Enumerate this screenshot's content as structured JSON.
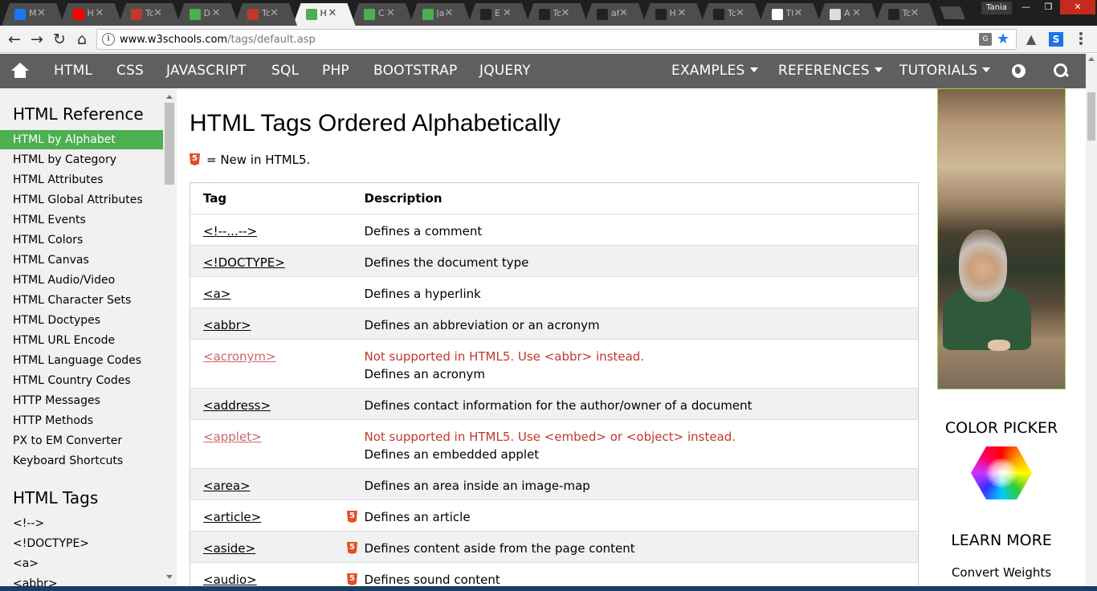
{
  "browser": {
    "tabs": [
      {
        "title": "M",
        "icon": "messenger-icon",
        "color": "#1877f2"
      },
      {
        "title": "H",
        "icon": "youtube-icon",
        "color": "#ff0000"
      },
      {
        "title": "Tc",
        "icon": "robot-icon",
        "color": "#c0392b"
      },
      {
        "title": "D",
        "icon": "leaf-icon",
        "color": "#4caf50"
      },
      {
        "title": "Tc",
        "icon": "robot-icon",
        "color": "#c0392b"
      },
      {
        "title": "H",
        "icon": "w3schools-icon",
        "color": "#4caf50",
        "active": true
      },
      {
        "title": "C",
        "icon": "w3schools-icon",
        "color": "#4caf50"
      },
      {
        "title": "Ja",
        "icon": "w3schools-icon",
        "color": "#4caf50"
      },
      {
        "title": "E",
        "icon": "github-icon",
        "color": "#222222"
      },
      {
        "title": "Tc",
        "icon": "github-icon",
        "color": "#222222"
      },
      {
        "title": "af",
        "icon": "github-icon",
        "color": "#222222"
      },
      {
        "title": "H",
        "icon": "github-icon",
        "color": "#222222"
      },
      {
        "title": "Tc",
        "icon": "github-icon",
        "color": "#222222"
      },
      {
        "title": "Tl",
        "icon": "wikipedia-icon",
        "color": "#ffffff"
      },
      {
        "title": "A",
        "icon": "document-icon",
        "color": "#dddddd"
      },
      {
        "title": "Tc",
        "icon": "github-icon",
        "color": "#222222"
      }
    ],
    "profile": "Tania",
    "url_host": "www.w3schools.com",
    "url_path": "/tags/default.asp"
  },
  "topnav": {
    "items": [
      "HTML",
      "CSS",
      "JAVASCRIPT",
      "SQL",
      "PHP",
      "BOOTSTRAP",
      "JQUERY"
    ],
    "dropdowns": [
      "EXAMPLES",
      "REFERENCES",
      "TUTORIALS"
    ]
  },
  "sidebar": {
    "reference_heading": "HTML Reference",
    "reference_links": [
      "HTML by Alphabet",
      "HTML by Category",
      "HTML Attributes",
      "HTML Global Attributes",
      "HTML Events",
      "HTML Colors",
      "HTML Canvas",
      "HTML Audio/Video",
      "HTML Character Sets",
      "HTML Doctypes",
      "HTML URL Encode",
      "HTML Language Codes",
      "HTML Country Codes",
      "HTTP Messages",
      "HTTP Methods",
      "PX to EM Converter",
      "Keyboard Shortcuts"
    ],
    "active_index": 0,
    "tags_heading": "HTML Tags",
    "tag_links": [
      "<!-->",
      "<!DOCTYPE>",
      "<a>",
      "<abbr>"
    ]
  },
  "main": {
    "title": "HTML Tags Ordered Alphabetically",
    "legend_text": "= New in HTML5.",
    "table_headers": [
      "Tag",
      "Description"
    ],
    "rows": [
      {
        "tag": "<!--...-->",
        "desc": "Defines a comment"
      },
      {
        "tag": "<!DOCTYPE>",
        "desc": "Defines the document type"
      },
      {
        "tag": "<a>",
        "desc": "Defines a hyperlink"
      },
      {
        "tag": "<abbr>",
        "desc": "Defines an abbreviation or an acronym"
      },
      {
        "tag": "<acronym>",
        "warn": "Not supported in HTML5. Use <abbr> instead.",
        "desc": "Defines an acronym",
        "deprecated": true
      },
      {
        "tag": "<address>",
        "desc": "Defines contact information for the author/owner of a document"
      },
      {
        "tag": "<applet>",
        "warn": "Not supported in HTML5. Use <embed> or <object> instead.",
        "desc": "Defines an embedded applet",
        "deprecated": true
      },
      {
        "tag": "<area>",
        "desc": "Defines an area inside an image-map"
      },
      {
        "tag": "<article>",
        "desc": "Defines an article",
        "new": true
      },
      {
        "tag": "<aside>",
        "desc": "Defines content aside from the page content",
        "new": true
      },
      {
        "tag": "<audio>",
        "desc": "Defines sound content",
        "new": true
      }
    ]
  },
  "right": {
    "color_picker_heading": "COLOR PICKER",
    "learn_more_heading": "LEARN MORE",
    "learn_more_link": "Convert Weights"
  },
  "colors": {
    "nav_bg": "#5f5f5f",
    "active_green": "#4caf50",
    "warning_red": "#c0392b",
    "html5_orange": "#e44d26"
  }
}
